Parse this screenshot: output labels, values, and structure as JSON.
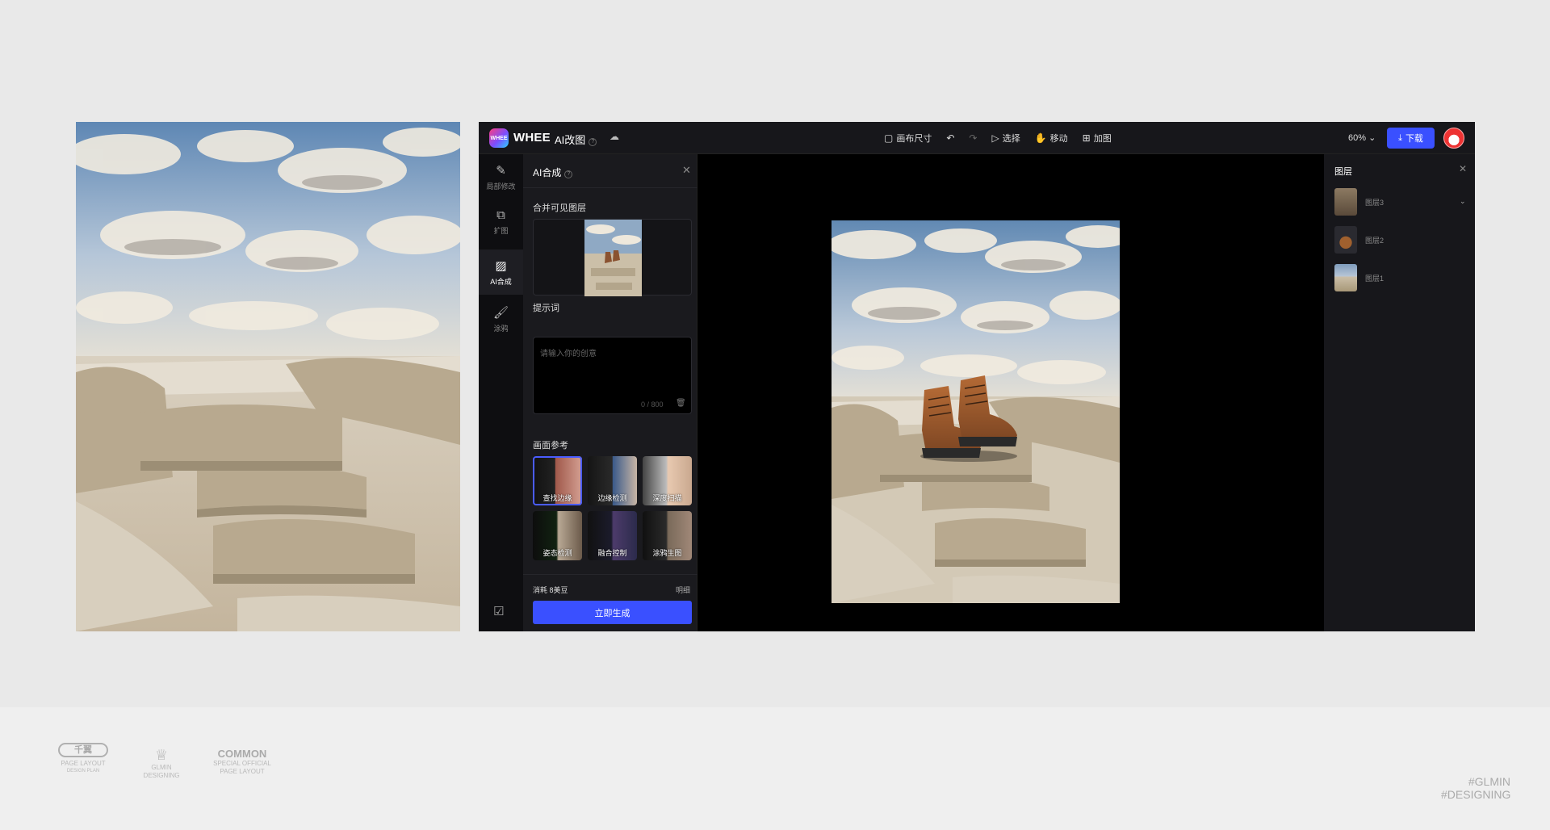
{
  "app": {
    "brand": "WHEE",
    "logo_text": "WHEE",
    "tool_title": "AI改图",
    "toolbar": {
      "canvas_size": "画布尺寸",
      "select": "选择",
      "move": "移动",
      "expand": "加图"
    },
    "zoom": "60%",
    "download": "下载"
  },
  "rail": {
    "items": [
      {
        "label": "局部修改",
        "icon": "edit-icon"
      },
      {
        "label": "扩图",
        "icon": "expand-icon"
      },
      {
        "label": "AI合成",
        "icon": "ai-compose-icon"
      },
      {
        "label": "涂鸦",
        "icon": "brush-icon"
      }
    ]
  },
  "panel": {
    "title": "AI合成",
    "merge_label": "合并可见图层",
    "prompt_label": "提示词",
    "prompt_placeholder": "请输入你的创意",
    "prompt_count": "0 / 800",
    "refs_label": "画面参考",
    "refs": [
      {
        "label": "查找边缘"
      },
      {
        "label": "边缘检测"
      },
      {
        "label": "深度扫描"
      },
      {
        "label": "姿态检测"
      },
      {
        "label": "融合控制"
      },
      {
        "label": "涂鸦生图"
      }
    ],
    "cost": "消耗 8美豆",
    "detail": "明细",
    "generate": "立即生成"
  },
  "layers": {
    "title": "图层",
    "items": [
      {
        "name": "图层3"
      },
      {
        "name": "图层2"
      },
      {
        "name": "图层1"
      }
    ]
  },
  "footer": {
    "logo1_main": "千翼",
    "logo1_sub": "PAGE LAYOUT",
    "logo1_tiny": "DESIGN PLAN",
    "logo2_main": "GLMIN",
    "logo2_sub": "DESIGNING",
    "logo3_main": "COMMON",
    "logo3_sub": "SPECIAL OFFICIAL",
    "logo3_tiny": "PAGE LAYOUT",
    "tag1": "#GLMIN",
    "tag2": "#DESIGNING"
  }
}
